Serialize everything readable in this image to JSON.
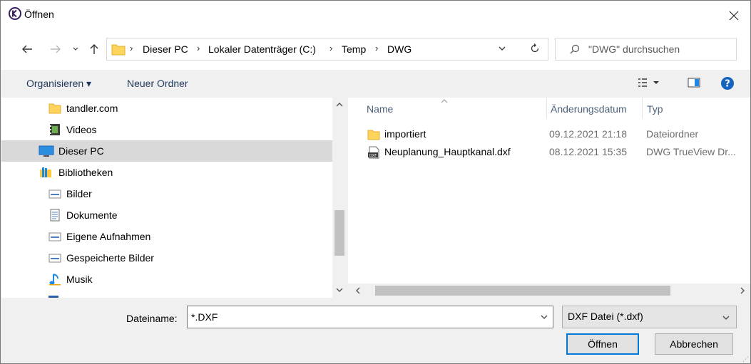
{
  "window": {
    "title": "Öffnen"
  },
  "address": {
    "crumbs": [
      "Dieser PC",
      "Lokaler Datenträger (C:)",
      "Temp",
      "DWG"
    ],
    "separator": "›"
  },
  "search": {
    "placeholder": "\"DWG\" durchsuchen"
  },
  "toolbar": {
    "organize": "Organisieren ▾",
    "new_folder": "Neuer Ordner"
  },
  "tree": [
    {
      "label": "tandler.com",
      "icon": "folder-icon"
    },
    {
      "label": "Videos",
      "icon": "video-icon"
    },
    {
      "label": "Dieser PC",
      "icon": "computer-icon",
      "selected": true
    },
    {
      "label": "Bibliotheken",
      "icon": "library-icon"
    },
    {
      "label": "Bilder",
      "icon": "picture-icon"
    },
    {
      "label": "Dokumente",
      "icon": "document-icon"
    },
    {
      "label": "Eigene Aufnahmen",
      "icon": "picture-icon"
    },
    {
      "label": "Gespeicherte Bilder",
      "icon": "picture-icon"
    },
    {
      "label": "Musik",
      "icon": "music-icon"
    }
  ],
  "columns": {
    "name": "Name",
    "date": "Änderungsdatum",
    "type": "Typ"
  },
  "files": [
    {
      "name": "importiert",
      "date": "09.12.2021 21:18",
      "type": "Dateiordner",
      "icon": "folder-icon"
    },
    {
      "name": "Neuplanung_Hauptkanal.dxf",
      "date": "08.12.2021 15:35",
      "type": "DWG TrueView Dr...",
      "icon": "dxf-file-icon"
    }
  ],
  "filename": {
    "label": "Dateiname:",
    "value": "*.DXF"
  },
  "filter": {
    "value": "DXF Datei (*.dxf)"
  },
  "buttons": {
    "open": "Öffnen",
    "cancel": "Abbrechen"
  },
  "colors": {
    "accent": "#0078d7",
    "folder": "#ffd45c",
    "selection": "#d9d9d9"
  }
}
